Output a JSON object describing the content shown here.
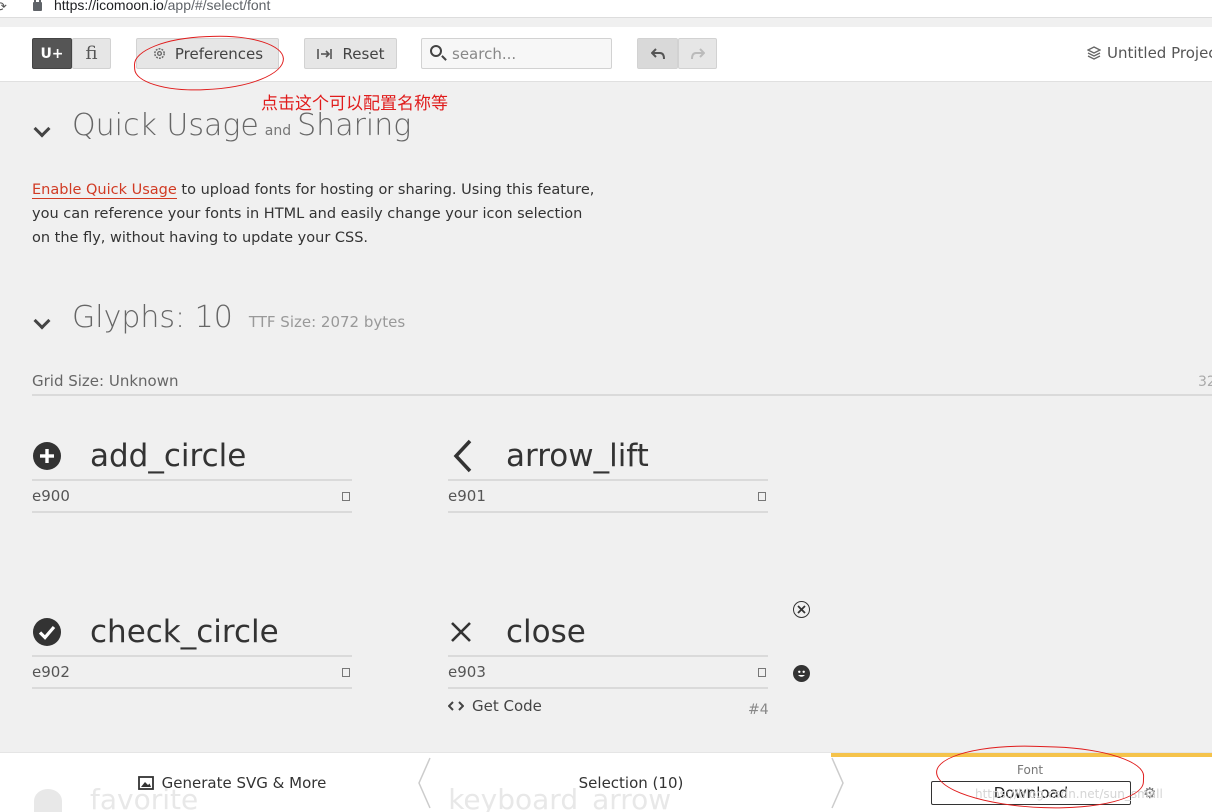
{
  "browser": {
    "url_host": "https://icomoon.io",
    "url_path": "/app/#/select/font"
  },
  "toolbar": {
    "uplus_label": "U+",
    "ligature_label": "fi",
    "preferences_label": "Preferences",
    "reset_label": "Reset",
    "search_placeholder": "search...",
    "project_name": "Untitled Project"
  },
  "annotation": {
    "text": "点击这个可以配置名称等"
  },
  "quick_usage": {
    "title_a": "Quick Usage",
    "title_and": "and",
    "title_b": "Sharing",
    "link_text": "Enable Quick Usage",
    "body_1": " to upload fonts for hosting or sharing. Using this feature,",
    "body_2": "you can reference your fonts in HTML and easily change your icon selection",
    "body_3": "on the fly, without having to update your CSS."
  },
  "glyphs": {
    "title": "Glyphs: 10",
    "ttf_size": "TTF Size: 2072 bytes",
    "grid_size": "Grid Size: Unknown",
    "grid_right": "32",
    "items": [
      {
        "name": "add_circle",
        "code": "e900",
        "icon": "add-circle-icon"
      },
      {
        "name": "arrow_lift",
        "code": "e901",
        "icon": "arrow-left-icon"
      },
      {
        "name": "check_circle",
        "code": "e902",
        "icon": "check-circle-icon"
      },
      {
        "name": "close",
        "code": "e903",
        "icon": "close-icon"
      }
    ],
    "get_code_label": "Get Code",
    "item_index": "#4",
    "ghost_row": [
      "favorite",
      "keyboard_arrow"
    ]
  },
  "bottom_bar": {
    "generate_label": "Generate SVG & More",
    "selection_label": "Selection (10)",
    "font_tab_label": "Font",
    "download_label": "Download",
    "accent_color": "#f5c34b"
  },
  "watermark": "https://blog.csdn.net/sun_small"
}
